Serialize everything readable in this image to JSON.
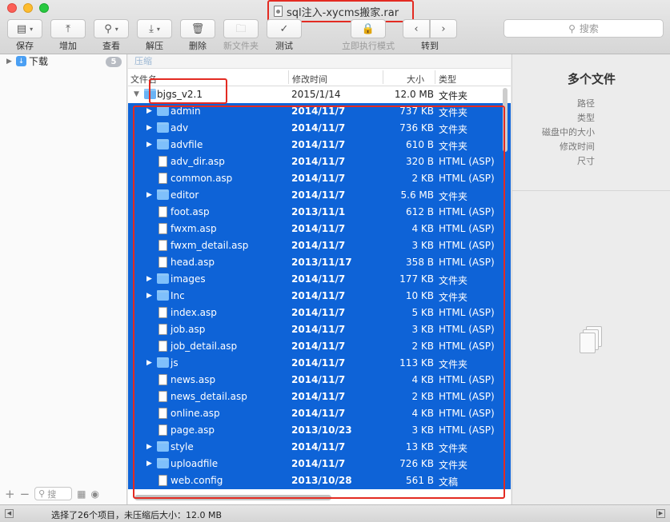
{
  "window": {
    "title": "sql注入-xycms搬家.rar",
    "accent_color": "#0e63d7",
    "annotation_color": "#e32b22"
  },
  "toolbar": {
    "save_label": "保存",
    "add_label": "增加",
    "view_label": "查看",
    "extract_label": "解压",
    "delete_label": "删除",
    "new_folder_label": "新文件夹",
    "test_label": "测试",
    "immediate_mode_label": "立即执行模式",
    "goto_label": "转到",
    "search_placeholder": "搜索"
  },
  "sidebar": {
    "item_label": "下载",
    "badge": "5",
    "search_placeholder": "搜"
  },
  "file_list": {
    "breadcrumb": "压缩",
    "columns": {
      "name": "文件名",
      "modified": "修改时间",
      "size": "大小",
      "type": "类型"
    },
    "root": {
      "name": "bjgs_v2.1",
      "modified": "2015/1/14",
      "size": "12.0 MB",
      "type": "文件夹"
    },
    "items": [
      {
        "name": "admin",
        "modified": "2014/11/7",
        "size": "737 KB",
        "type": "文件夹",
        "kind": "folder"
      },
      {
        "name": "adv",
        "modified": "2014/11/7",
        "size": "736 KB",
        "type": "文件夹",
        "kind": "folder"
      },
      {
        "name": "advfile",
        "modified": "2014/11/7",
        "size": "610 B",
        "type": "文件夹",
        "kind": "folder"
      },
      {
        "name": "adv_dir.asp",
        "modified": "2014/11/7",
        "size": "320 B",
        "type": "HTML (ASP)",
        "kind": "file"
      },
      {
        "name": "common.asp",
        "modified": "2014/11/7",
        "size": "2 KB",
        "type": "HTML (ASP)",
        "kind": "file"
      },
      {
        "name": "editor",
        "modified": "2014/11/7",
        "size": "5.6 MB",
        "type": "文件夹",
        "kind": "folder"
      },
      {
        "name": "foot.asp",
        "modified": "2013/11/1",
        "size": "612 B",
        "type": "HTML (ASP)",
        "kind": "file"
      },
      {
        "name": "fwxm.asp",
        "modified": "2014/11/7",
        "size": "4 KB",
        "type": "HTML (ASP)",
        "kind": "file"
      },
      {
        "name": "fwxm_detail.asp",
        "modified": "2014/11/7",
        "size": "3 KB",
        "type": "HTML (ASP)",
        "kind": "file"
      },
      {
        "name": "head.asp",
        "modified": "2013/11/17",
        "size": "358 B",
        "type": "HTML (ASP)",
        "kind": "file"
      },
      {
        "name": "images",
        "modified": "2014/11/7",
        "size": "177 KB",
        "type": "文件夹",
        "kind": "folder"
      },
      {
        "name": "Inc",
        "modified": "2014/11/7",
        "size": "10 KB",
        "type": "文件夹",
        "kind": "folder"
      },
      {
        "name": "index.asp",
        "modified": "2014/11/7",
        "size": "5 KB",
        "type": "HTML (ASP)",
        "kind": "file"
      },
      {
        "name": "job.asp",
        "modified": "2014/11/7",
        "size": "3 KB",
        "type": "HTML (ASP)",
        "kind": "file"
      },
      {
        "name": "job_detail.asp",
        "modified": "2014/11/7",
        "size": "2 KB",
        "type": "HTML (ASP)",
        "kind": "file"
      },
      {
        "name": "js",
        "modified": "2014/11/7",
        "size": "113 KB",
        "type": "文件夹",
        "kind": "folder"
      },
      {
        "name": "news.asp",
        "modified": "2014/11/7",
        "size": "4 KB",
        "type": "HTML (ASP)",
        "kind": "file"
      },
      {
        "name": "news_detail.asp",
        "modified": "2014/11/7",
        "size": "2 KB",
        "type": "HTML (ASP)",
        "kind": "file"
      },
      {
        "name": "online.asp",
        "modified": "2014/11/7",
        "size": "4 KB",
        "type": "HTML (ASP)",
        "kind": "file"
      },
      {
        "name": "page.asp",
        "modified": "2013/10/23",
        "size": "3 KB",
        "type": "HTML (ASP)",
        "kind": "file"
      },
      {
        "name": "style",
        "modified": "2014/11/7",
        "size": "13 KB",
        "type": "文件夹",
        "kind": "folder"
      },
      {
        "name": "uploadfile",
        "modified": "2014/11/7",
        "size": "726 KB",
        "type": "文件夹",
        "kind": "folder"
      },
      {
        "name": "web.config",
        "modified": "2013/10/28",
        "size": "561 B",
        "type": "文稿",
        "kind": "file"
      }
    ]
  },
  "inspector": {
    "title": "多个文件",
    "labels": {
      "path": "路径",
      "kind": "类型",
      "disk_size": "磁盘中的大小",
      "modified": "修改时间",
      "dimensions": "尺寸"
    }
  },
  "status": {
    "text": "选择了26个项目，未压缩后大小：12.0 MB"
  }
}
